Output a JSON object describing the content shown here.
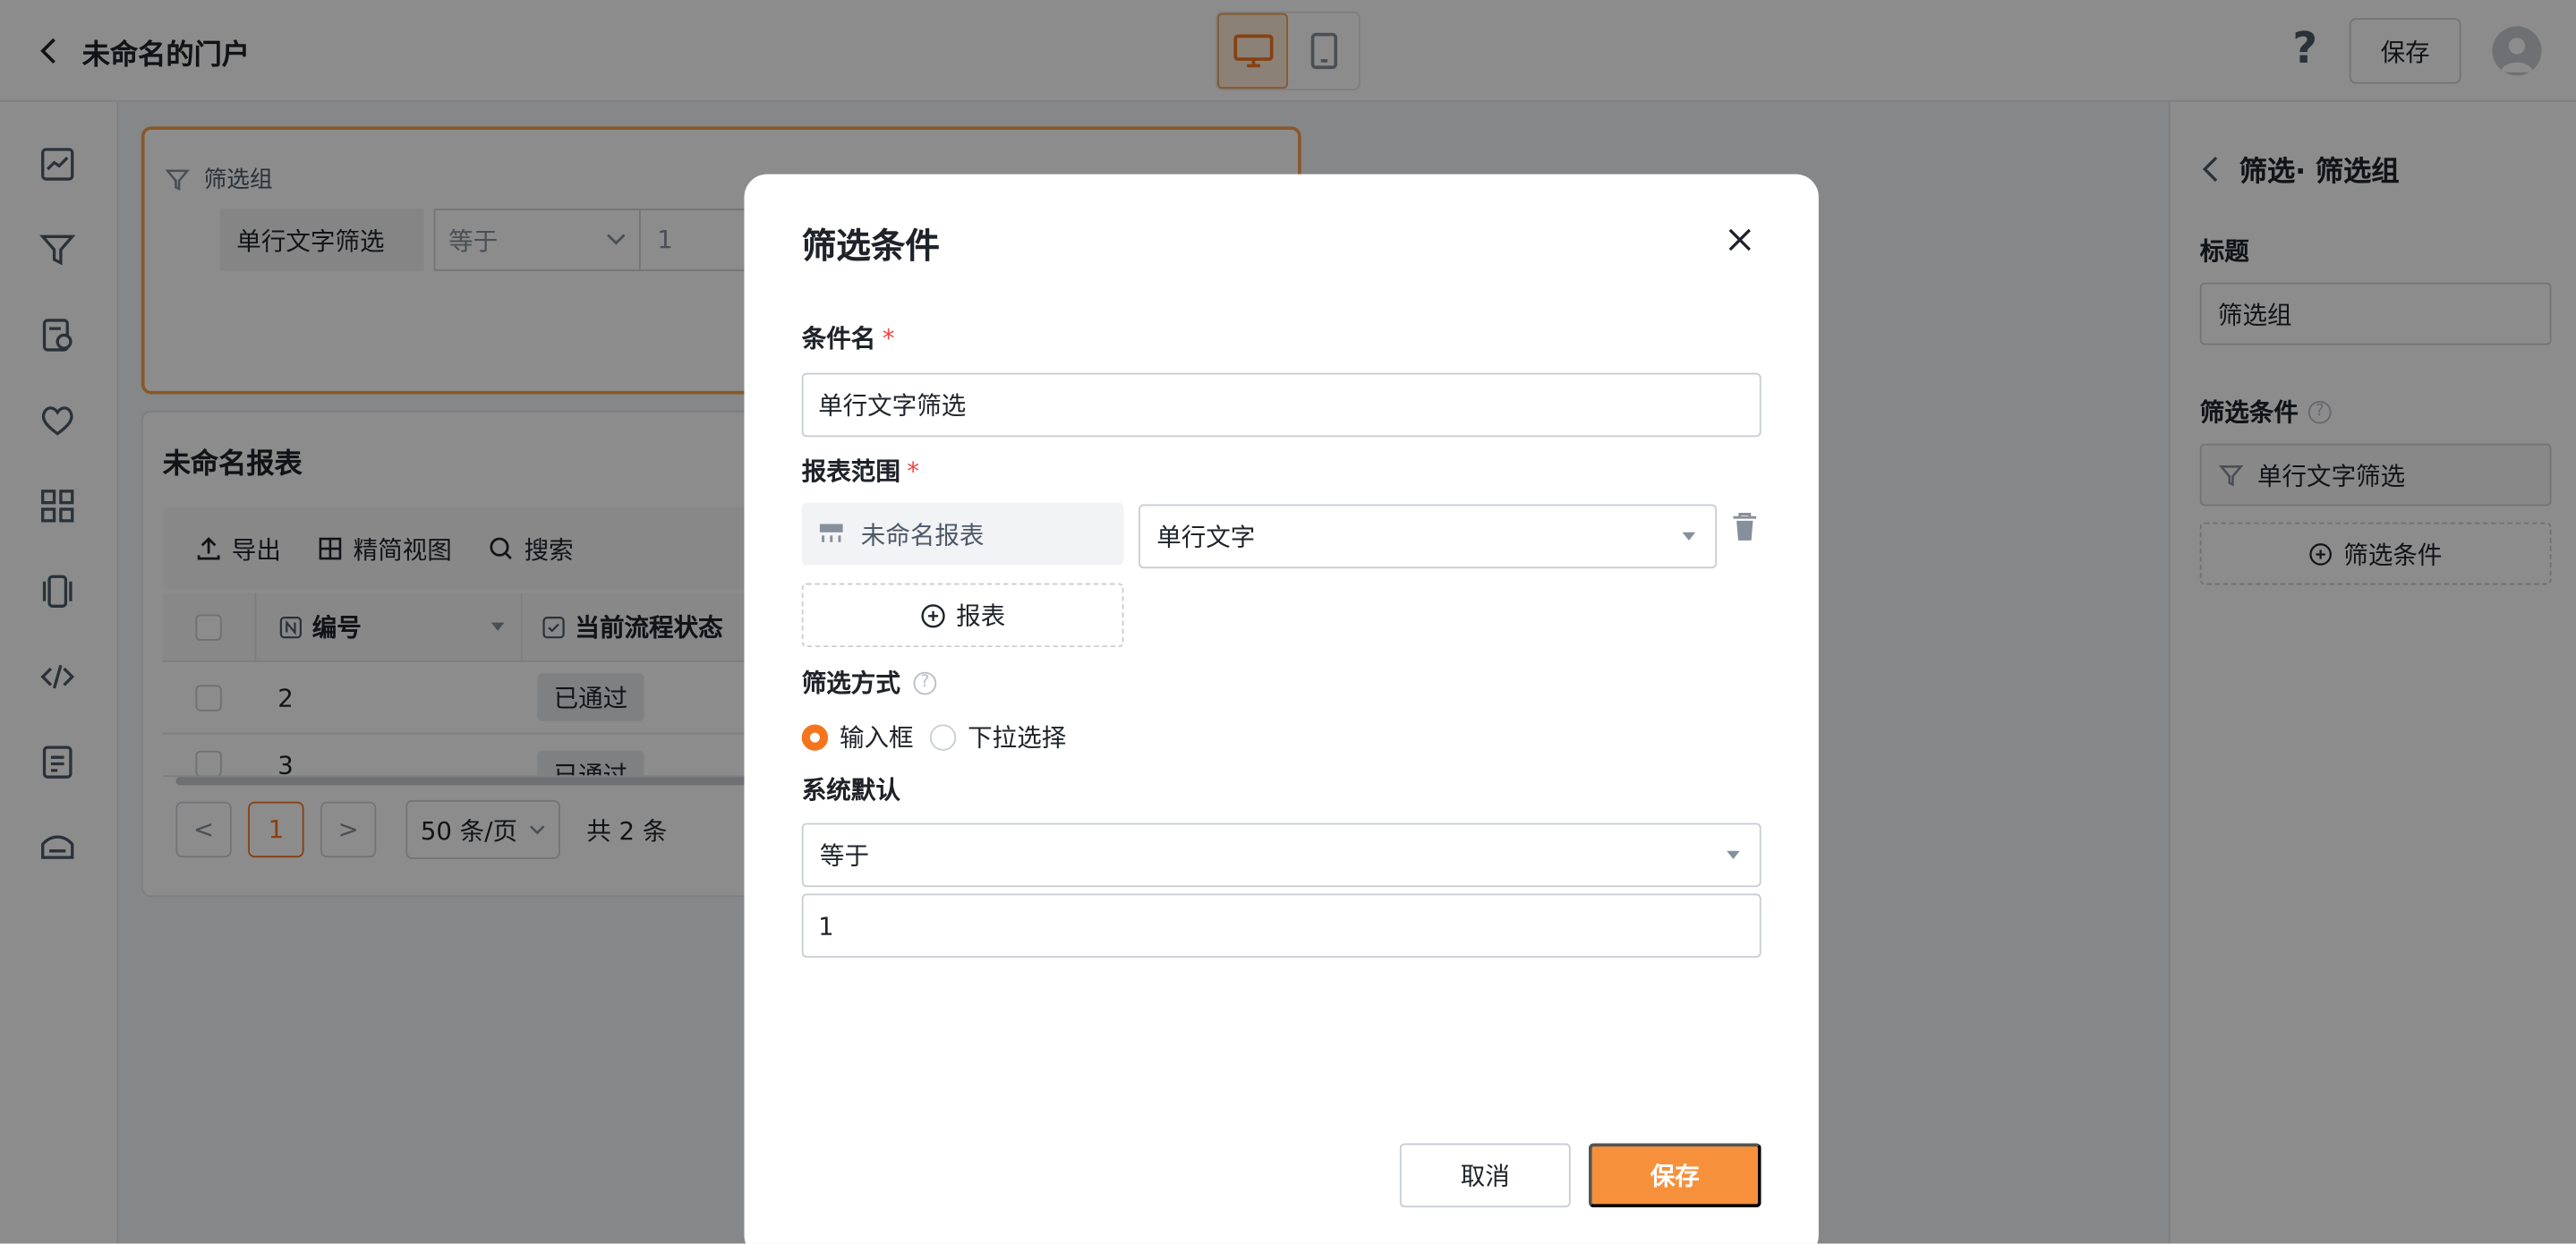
{
  "header": {
    "title": "未命名的门户",
    "save_label": "保存",
    "help_symbol": "?"
  },
  "filter_group": {
    "title": "筛选组",
    "field_label": "单行文字筛选",
    "operator": "等于",
    "value": "1"
  },
  "report": {
    "title": "未命名报表",
    "toolbar": {
      "export": "导出",
      "simple_view": "精简视图",
      "search": "搜索"
    },
    "columns": [
      "编号",
      "当前流程状态"
    ],
    "rows": [
      {
        "id": "2",
        "status": "已通过"
      },
      {
        "id": "3",
        "status": "已通过"
      }
    ],
    "pager": {
      "prev": "<",
      "current_page": "1",
      "next": ">",
      "page_size": "50 条/页",
      "total": "共 2 条"
    }
  },
  "right_panel": {
    "heading": "筛选· 筛选组",
    "title_label": "标题",
    "title_value": "筛选组",
    "conditions_label": "筛选条件",
    "condition_item": "单行文字筛选",
    "add_condition": "筛选条件"
  },
  "modal": {
    "title": "筛选条件",
    "condition_name_label": "条件名",
    "condition_name_value": "单行文字筛选",
    "report_scope_label": "报表范围",
    "report_name": "未命名报表",
    "report_field": "单行文字",
    "add_report": "报表",
    "filter_mode_label": "筛选方式",
    "filter_mode_options": [
      "输入框",
      "下拉选择"
    ],
    "filter_mode_selected": "输入框",
    "default_label": "系统默认",
    "default_operator": "等于",
    "default_value": "1",
    "cancel_label": "取消",
    "save_label": "保存"
  },
  "colors": {
    "accent": "#f6903a",
    "accent_border": "#f6a04d",
    "required": "#f53f3f"
  }
}
